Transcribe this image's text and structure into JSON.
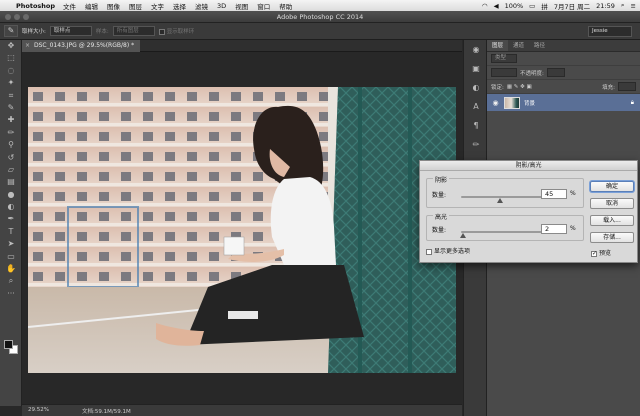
{
  "menubar": {
    "app_name": "Photoshop",
    "items": [
      "文件",
      "编辑",
      "图像",
      "图层",
      "文字",
      "选择",
      "滤镜",
      "3D",
      "视图",
      "窗口",
      "帮助"
    ],
    "battery": "100%",
    "date": "7月7日 周二",
    "time": "21:59"
  },
  "window": {
    "title": "Adobe Photoshop CC 2014"
  },
  "options": {
    "sample_label": "取样大小:",
    "sample_value": "取样点",
    "sample_dim_label": "样本:",
    "sample_dim_value": "所有图层",
    "show_ring": "显示取样环",
    "workspace": "Jessie"
  },
  "document": {
    "tab_label": "DSC_0143.JPG @ 29.5%(RGB/8) *",
    "close": "×",
    "zoom": "29.52%",
    "doc_info": "文档:59.1M/59.1M"
  },
  "panel": {
    "tabs": [
      "图层",
      "通道",
      "路径"
    ],
    "kind_label": "类型",
    "opacity_label": "不透明度:",
    "lock_label": "锁定:",
    "fill_label": "填充:",
    "layer_name": "背景"
  },
  "dialog": {
    "title": "阴影/高光",
    "shadows": {
      "label": "阴影",
      "amount_label": "数量:",
      "value": "45",
      "unit": "%",
      "level": 0.45
    },
    "highlights": {
      "label": "高光",
      "amount_label": "数量:",
      "value": "2",
      "unit": "%",
      "level": 0.02
    },
    "more_options": "显示更多选项",
    "buttons": {
      "ok": "确定",
      "cancel": "取消",
      "load": "载入...",
      "save": "存储..."
    },
    "preview_label": "预览"
  },
  "colors": {
    "accent": "#5a6f96",
    "dialog_bg": "#d9d9d9",
    "canvas_bg": "#282828"
  }
}
